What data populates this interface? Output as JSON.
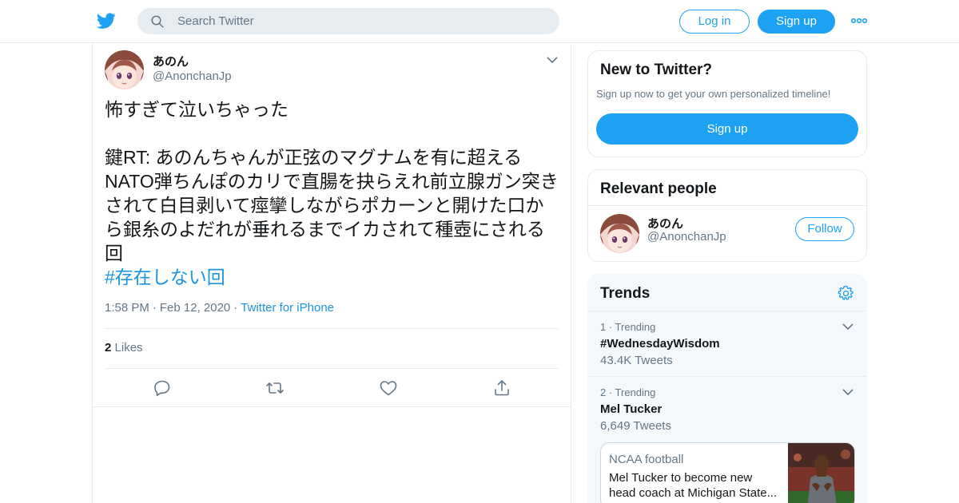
{
  "header": {
    "logo_icon": "twitter-bird-icon",
    "search_placeholder": "Search Twitter",
    "login_label": "Log in",
    "signup_label": "Sign up",
    "more_icon": "more-dots-icon",
    "brand_color": "#1da1f2"
  },
  "tweet": {
    "author_name": "あのん",
    "author_handle": "@AnonchanJp",
    "text_line1": "怖すぎて泣いちゃった",
    "text_body": "鍵RT: あのんちゃんが正弦のマグナムを有に超えるNATO弾ちんぽのカリで直腸を抉らえれ前立腺ガン突きされて白目剥いて痙攣しながらポカーンと開けた口から銀糸のよだれが垂れるまでイカされて種壺にされる回",
    "hashtag": "#存在しない回",
    "time": "1:58 PM",
    "date": "Feb 12, 2020",
    "source": "Twitter for iPhone",
    "likes_count": "2",
    "likes_label": "Likes",
    "actions": [
      "reply-icon",
      "retweet-icon",
      "like-icon",
      "share-icon"
    ]
  },
  "sidebar": {
    "new_card": {
      "title": "New to Twitter?",
      "subtitle": "Sign up now to get your own personalized timeline!",
      "button_label": "Sign up"
    },
    "people_card": {
      "title": "Relevant people",
      "name": "あのん",
      "handle": "@AnonchanJp",
      "follow_label": "Follow"
    },
    "trends_card": {
      "title": "Trends",
      "items": [
        {
          "meta": "1 · Trending",
          "name": "#WednesdayWisdom",
          "count": "43.4K Tweets"
        },
        {
          "meta": "2 · Trending",
          "name": "Mel Tucker",
          "count": "6,649 Tweets"
        }
      ],
      "news": {
        "category": "NCAA football",
        "headline": "Mel Tucker to become new head coach at Michigan State..."
      }
    }
  }
}
